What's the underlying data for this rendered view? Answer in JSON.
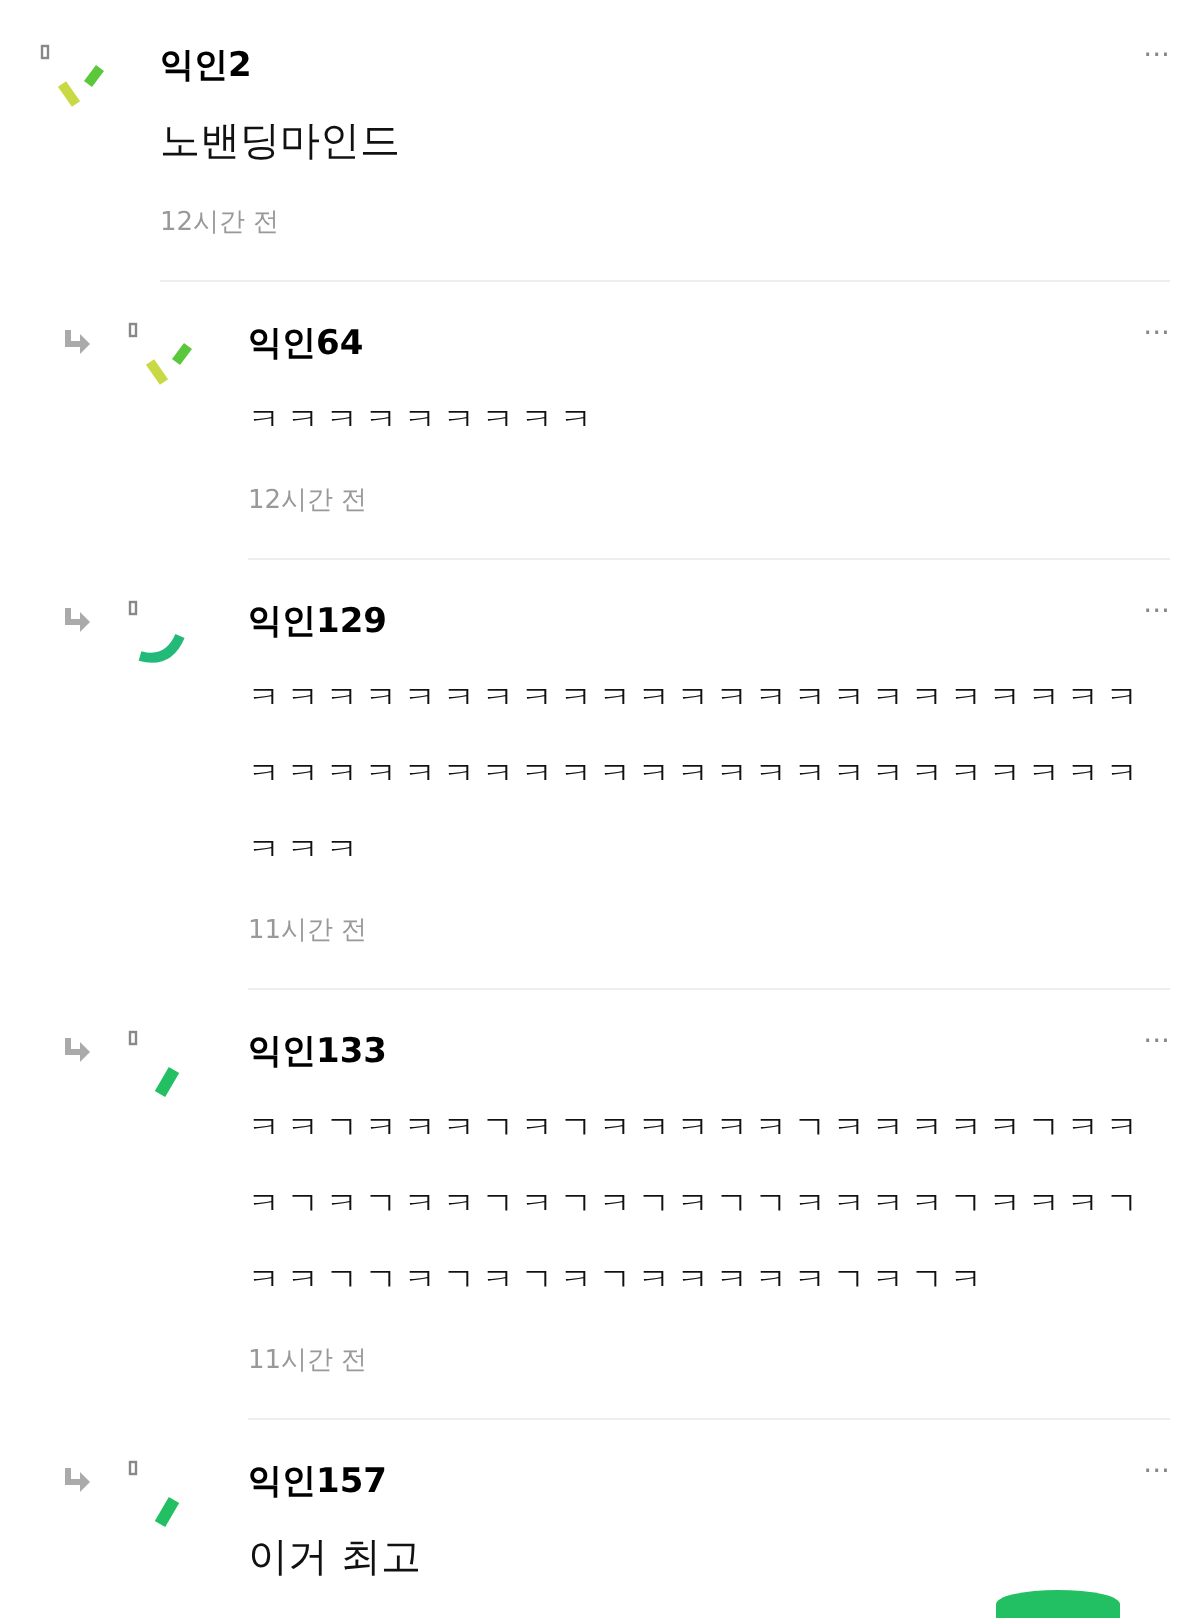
{
  "comments": [
    {
      "reply": false,
      "author": "익인2",
      "avatar": {
        "kind": "sticks"
      },
      "kind": "plain",
      "text": "노밴딩마인드",
      "time": "12시간 전",
      "menu": "···"
    },
    {
      "reply": true,
      "author": "익인64",
      "avatar": {
        "kind": "sticks"
      },
      "kind": "spaced",
      "text": "ㅋㅋㅋㅋㅋㅋㅋㅋㅋ",
      "time": "12시간 전",
      "menu": "···"
    },
    {
      "reply": true,
      "author": "익인129",
      "avatar": {
        "kind": "arc"
      },
      "kind": "spaced",
      "text": "ㅋㅋㅋㅋㅋㅋㅋㅋㅋㅋㅋㅋㅋㅋㅋㅋㅋㅋㅋㅋㅋㅋㅋㅋㅋㅋㅋㅋㅋㅋㅋㅋㅋㅋㅋㅋㅋㅋㅋㅋㅋㅋㅋㅋㅋㅋㅋㅋㅋ",
      "time": "11시간 전",
      "menu": "···"
    },
    {
      "reply": true,
      "author": "익인133",
      "avatar": {
        "kind": "slash"
      },
      "kind": "spaced",
      "text": "ㅋㅋㄱㅋㅋㅋㄱㅋㄱㅋㅋㅋㅋㅋㄱㅋㅋㅋㅋㅋㄱㅋㅋㅋㄱㅋㄱㅋㅋㄱㅋㄱㅋㄱㅋㄱㄱㅋㅋㅋㅋㄱㅋㅋㅋㄱㅋㅋㄱㄱㅋㄱㅋㄱㅋㄱㅋㅋㅋㅋㅋㄱㅋㄱㅋ",
      "time": "11시간 전",
      "menu": "···"
    },
    {
      "reply": true,
      "author": "익인157",
      "avatar": {
        "kind": "slash"
      },
      "kind": "plain",
      "text": "이거 최고",
      "menu": "···"
    }
  ]
}
